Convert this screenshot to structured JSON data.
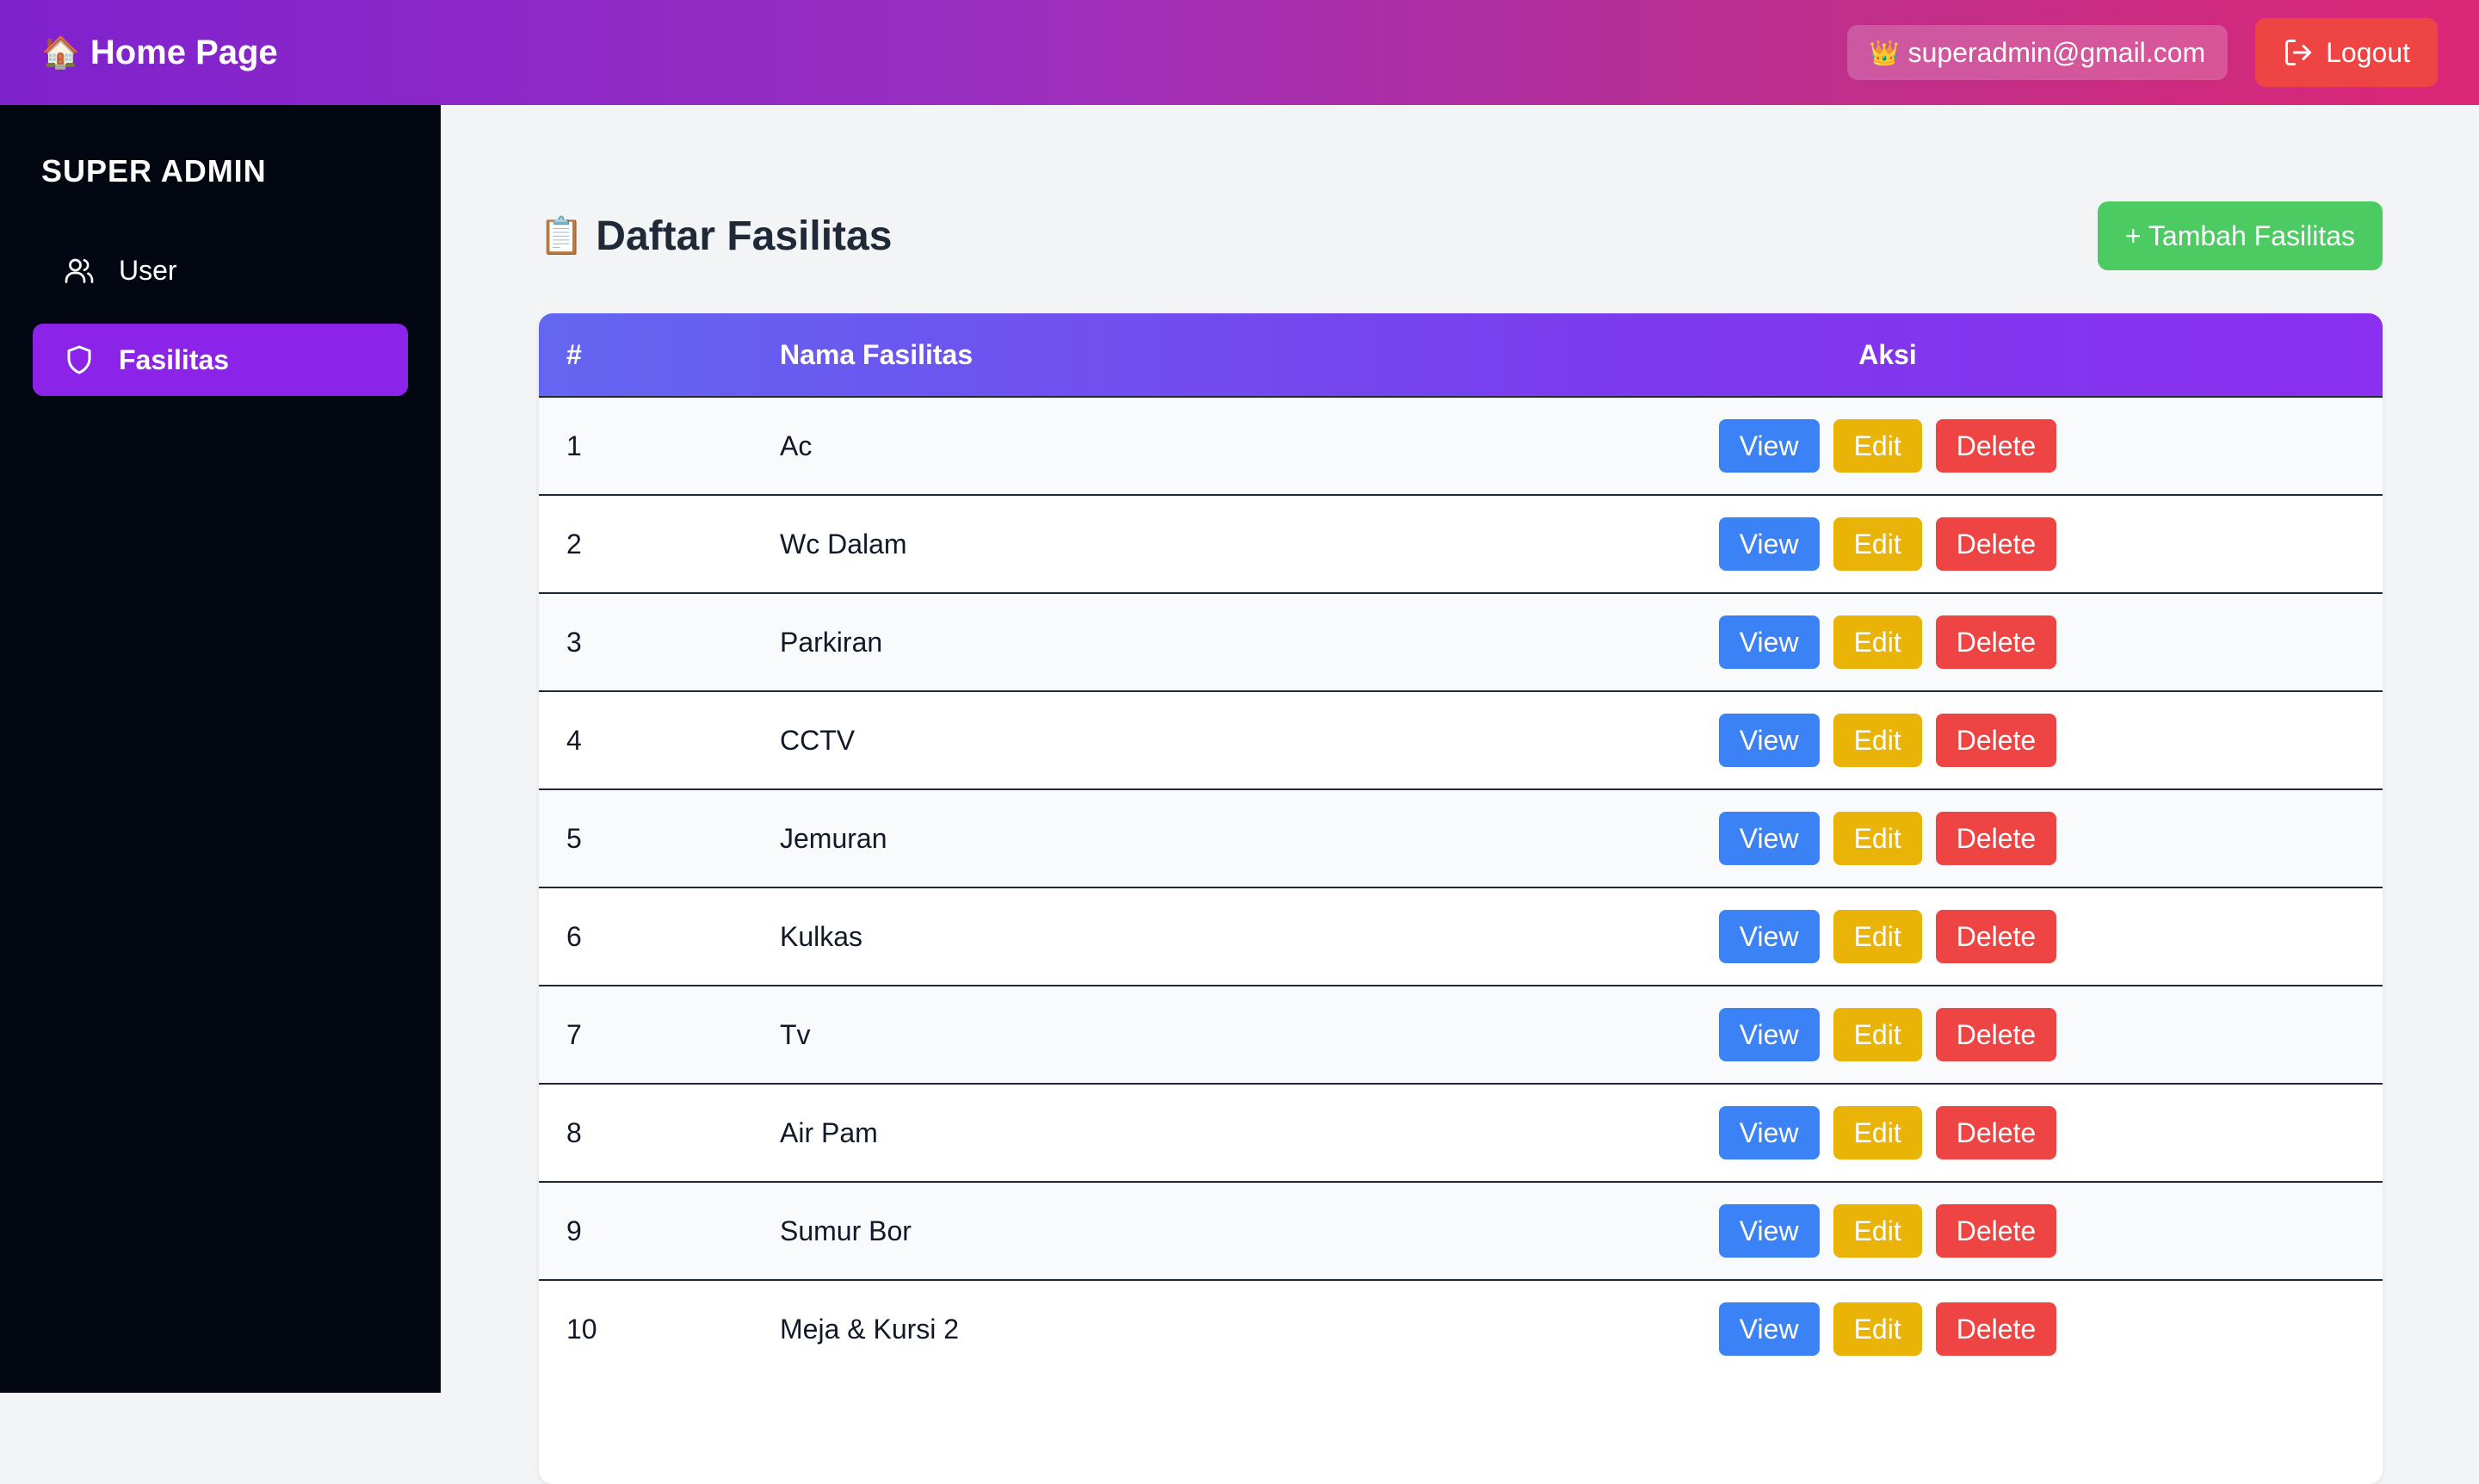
{
  "header": {
    "brand_icon": "🏠",
    "title": "Home Page",
    "user_icon": "👑",
    "user_email": "superadmin@gmail.com",
    "logout_label": "Logout"
  },
  "sidebar": {
    "title": "SUPER ADMIN",
    "items": [
      {
        "label": "User",
        "icon": "users-icon",
        "active": false
      },
      {
        "label": "Fasilitas",
        "icon": "shield-icon",
        "active": true
      }
    ]
  },
  "main": {
    "title_icon": "📋",
    "title": "Daftar Fasilitas",
    "add_button_label": "+ Tambah Fasilitas",
    "table": {
      "headers": [
        "#",
        "Nama Fasilitas",
        "Aksi"
      ],
      "rows": [
        {
          "no": "1",
          "name": "Ac"
        },
        {
          "no": "2",
          "name": "Wc Dalam"
        },
        {
          "no": "3",
          "name": "Parkiran"
        },
        {
          "no": "4",
          "name": "CCTV"
        },
        {
          "no": "5",
          "name": "Jemuran"
        },
        {
          "no": "6",
          "name": "Kulkas"
        },
        {
          "no": "7",
          "name": "Tv"
        },
        {
          "no": "8",
          "name": "Air Pam"
        },
        {
          "no": "9",
          "name": "Sumur Bor"
        },
        {
          "no": "10",
          "name": "Meja & Kursi 2"
        }
      ],
      "actions": {
        "view": "View",
        "edit": "Edit",
        "delete": "Delete"
      }
    }
  },
  "colors": {
    "sidebar_bg": "#030712",
    "active_item": "#8b23e8",
    "view": "#3b82f6",
    "edit": "#eab308",
    "delete": "#ef4444",
    "add": "#4ccb62"
  }
}
